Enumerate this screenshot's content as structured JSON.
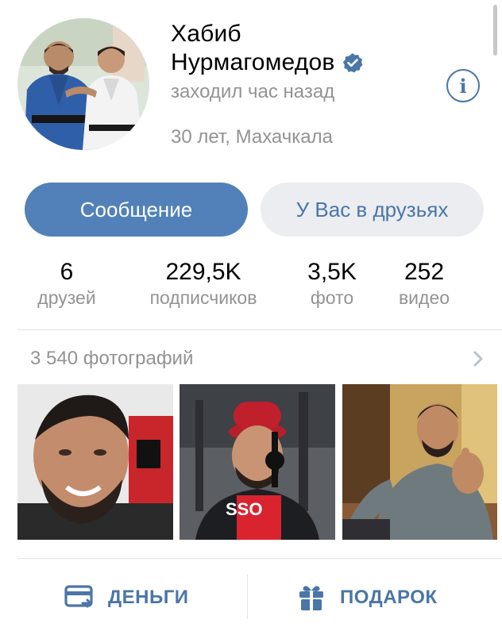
{
  "profile": {
    "name_line1": "Хабиб",
    "name_line2": "Нурмагомедов",
    "last_seen": "заходил час назад",
    "location": "30 лет, Махачкала",
    "verified_icon": "verified-checkmark",
    "info_icon": "info-icon"
  },
  "actions": {
    "message_label": "Сообщение",
    "friends_label": "У Вас в друзьях"
  },
  "stats": [
    {
      "value": "6",
      "label": "друзей"
    },
    {
      "value": "229,5K",
      "label": "подписчиков"
    },
    {
      "value": "3,5K",
      "label": "фото"
    },
    {
      "value": "252",
      "label": "видео"
    }
  ],
  "photos": {
    "count_label": "3 540 фотографий"
  },
  "bottom": {
    "money_label": "ДЕНЬГИ",
    "gift_label": "ПОДАРОК"
  },
  "colors": {
    "accent": "#5181b8",
    "link": "#4a76a8",
    "secondary_text": "#939393",
    "button_secondary_bg": "#ebedf0"
  }
}
